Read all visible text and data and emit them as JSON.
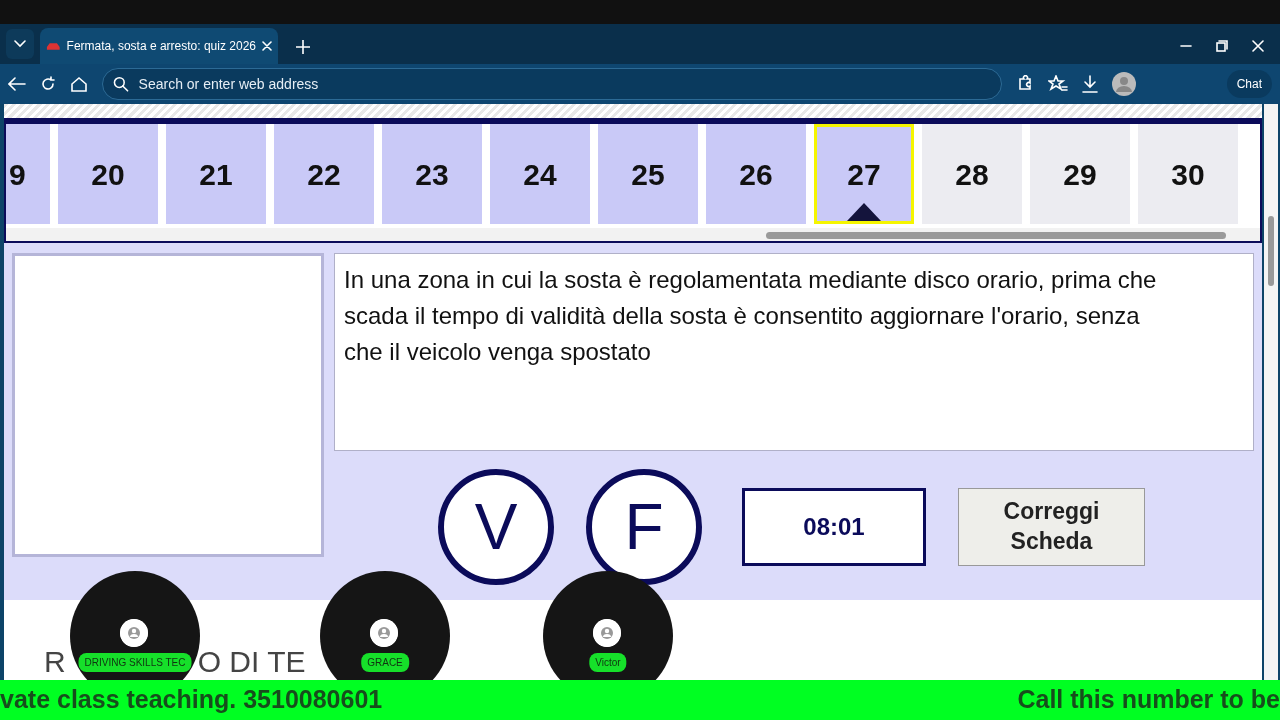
{
  "browser": {
    "tab": {
      "title": "Fermata, sosta e arresto: quiz 2026",
      "selected": true
    },
    "address_placeholder": "Search or enter web address",
    "chat_label": "Chat"
  },
  "questions": [
    {
      "number": "9",
      "answered": true,
      "selected": false
    },
    {
      "number": "20",
      "answered": true,
      "selected": false
    },
    {
      "number": "21",
      "answered": true,
      "selected": false
    },
    {
      "number": "22",
      "answered": true,
      "selected": false
    },
    {
      "number": "23",
      "answered": true,
      "selected": false
    },
    {
      "number": "24",
      "answered": true,
      "selected": false
    },
    {
      "number": "25",
      "answered": true,
      "selected": false
    },
    {
      "number": "26",
      "answered": true,
      "selected": false
    },
    {
      "number": "27",
      "answered": true,
      "selected": true
    },
    {
      "number": "28",
      "answered": false,
      "selected": false
    },
    {
      "number": "29",
      "answered": false,
      "selected": false
    },
    {
      "number": "30",
      "answered": false,
      "selected": false
    }
  ],
  "question_text": "In una zona in cui la sosta è regolamentata mediante disco orario, prima che scada il tempo di validità della sosta è consentito aggiornare l'orario, senza che il veicolo venga spostato",
  "answers": [
    "V",
    "F"
  ],
  "timer": "08:01",
  "check_button": "Correggi Scheda",
  "heading_fragments": [
    "R",
    "O DI TE"
  ],
  "participants": [
    "DRIVING SKILLS TEC",
    "GRACE",
    "Victor"
  ],
  "ticker": [
    "vate class teaching. 3510080601",
    "Call this number to be"
  ]
}
